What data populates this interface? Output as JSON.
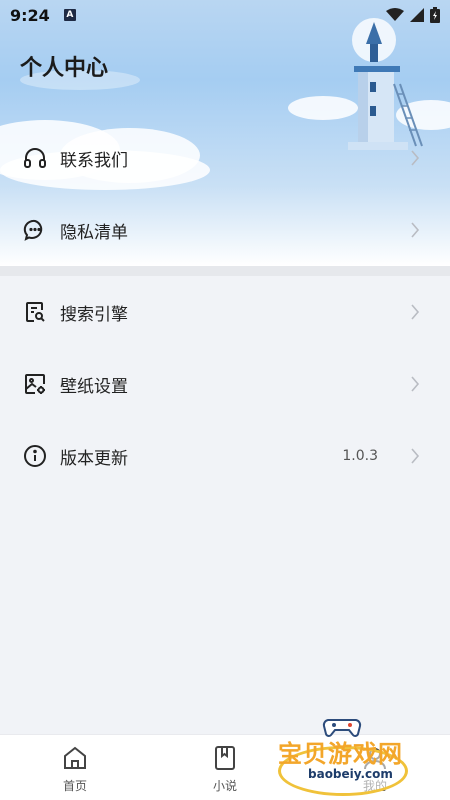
{
  "status_bar": {
    "time": "9:24",
    "notification_badge": "A"
  },
  "header": {
    "title": "个人中心"
  },
  "menu": [
    {
      "label": "联系我们",
      "icon": "headset-icon",
      "value": ""
    },
    {
      "label": "隐私清单",
      "icon": "chat-bubble-icon",
      "value": ""
    },
    {
      "label": "搜索引擎",
      "icon": "search-document-icon",
      "value": ""
    },
    {
      "label": "壁纸设置",
      "icon": "image-settings-icon",
      "value": ""
    },
    {
      "label": "版本更新",
      "icon": "info-icon",
      "value": "1.0.3"
    }
  ],
  "tabbar": [
    {
      "label": "首页",
      "icon": "home-icon"
    },
    {
      "label": "小说",
      "icon": "book-icon"
    },
    {
      "label": "我的",
      "icon": "profile-icon"
    }
  ],
  "watermark": {
    "text": "宝贝游戏网",
    "sub": "baobeiy.com"
  },
  "colors": {
    "accent": "#f3a62a",
    "sky": "#a5cdf2",
    "background": "#f1f3f7"
  }
}
